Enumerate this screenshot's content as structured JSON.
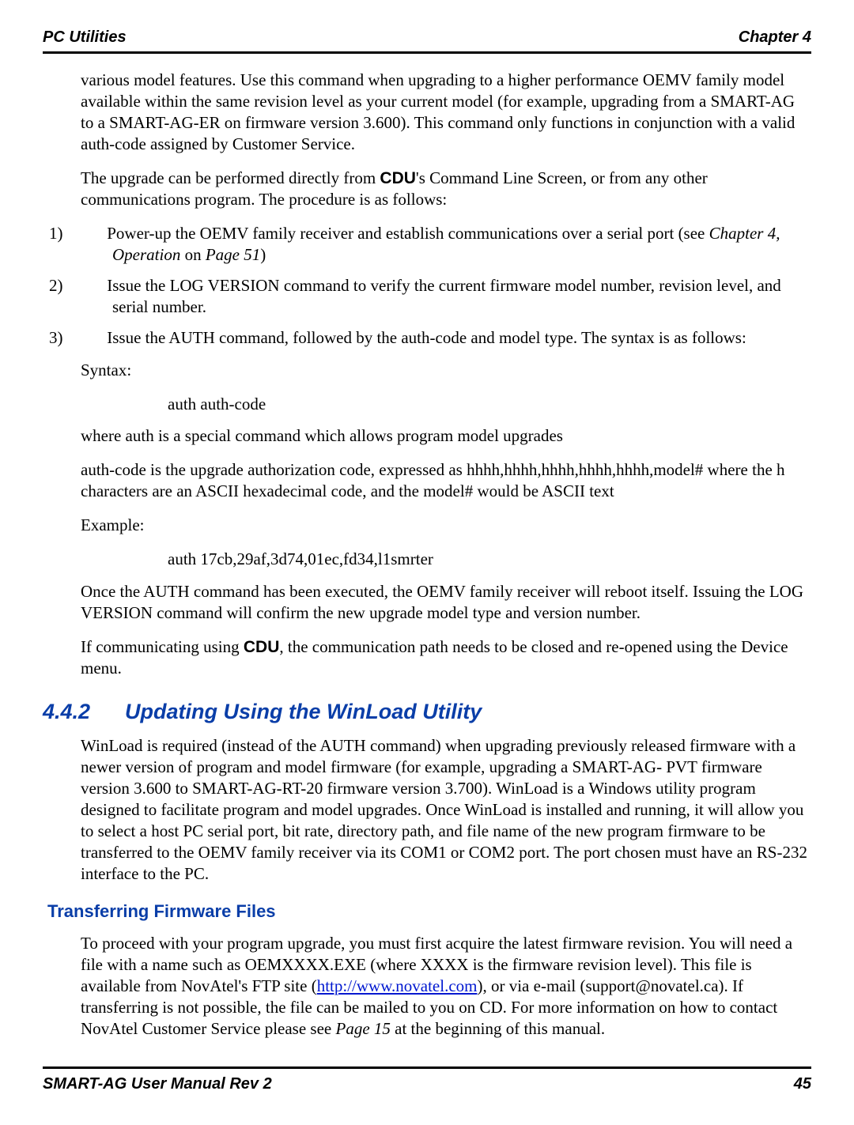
{
  "header": {
    "left": "PC Utilities",
    "right": "Chapter 4"
  },
  "p1": "various model features. Use this command when upgrading to a higher performance OEMV family model available within the same revision level as your current model (for example, upgrading from a SMART-AG to a SMART-AG-ER on firmware version 3.600). This command only functions in conjunction with a valid auth-code assigned by Customer Service.",
  "p2a": "The upgrade can be performed directly from ",
  "p2b": "CDU",
  "p2c": "'s Command Line Screen, or from any other communications program. The procedure is as follows:",
  "ol": [
    {
      "num": "1)",
      "a": "Power-up the OEMV family receiver and establish communications over a serial port (see ",
      "i1": "Chapter 4, Operation",
      "mid": " on ",
      "i2": "Page 51",
      "end": ")"
    },
    {
      "num": "2)",
      "a": "Issue the LOG VERSION command to verify the current firmware model number, revision level, and serial number."
    },
    {
      "num": "3)",
      "a": "Issue the AUTH command, followed by the auth-code and model type. The syntax is as follows:"
    }
  ],
  "syntax_label": "Syntax:",
  "syntax_code": "auth auth-code",
  "where_line": "where auth is a special command which allows program model upgrades",
  "auth_desc": "auth-code is the upgrade authorization code, expressed as hhhh,hhhh,hhhh,hhhh,hhhh,model# where the h characters are an ASCII hexadecimal code, and the model# would be ASCII text",
  "example_label": "Example:",
  "example_code": "auth 17cb,29af,3d74,01ec,fd34,l1smrter",
  "after_example": "Once the AUTH command has been executed, the OEMV family receiver will reboot itself. Issuing the LOG VERSION command will confirm the new upgrade model type and version number.",
  "cdu_line_a": "If communicating using ",
  "cdu_line_b": "CDU",
  "cdu_line_c": ", the communication path needs to be closed and re-opened using the Device menu.",
  "h2_num": "4.4.2",
  "h2_text": "Updating Using the WinLoad Utility",
  "winload_para": "WinLoad is required (instead of the AUTH command) when upgrading previously released firmware with a newer version of program and model firmware (for example, upgrading a SMART-AG- PVT firmware version 3.600 to SMART-AG-RT-20 firmware version 3.700). WinLoad is a Windows utility program designed to facilitate program and model upgrades. Once WinLoad is installed and running, it will allow you to select a host PC serial port, bit rate, directory path, and file name of the new program firmware to be transferred to the OEMV family receiver via its COM1 or COM2 port. The port chosen must have an RS-232 interface to the PC.",
  "h3_text": "Transferring Firmware Files",
  "tf_a": "To proceed with your program upgrade, you must first acquire the latest firmware revision. You will need a file with a name such as OEMXXXX.EXE (where XXXX is the firmware revision level). This file is available from NovAtel's FTP site (",
  "tf_link": "http://www.novatel.com",
  "tf_b": "), or via e-mail (support@novatel.ca). If transferring is not possible, the file can be mailed to you on CD. For more information on how to contact NovAtel Customer Service please see ",
  "tf_page": "Page 15",
  "tf_c": " at the beginning of this manual.",
  "footer": {
    "left": "SMART-AG User Manual Rev 2",
    "right": "45"
  }
}
